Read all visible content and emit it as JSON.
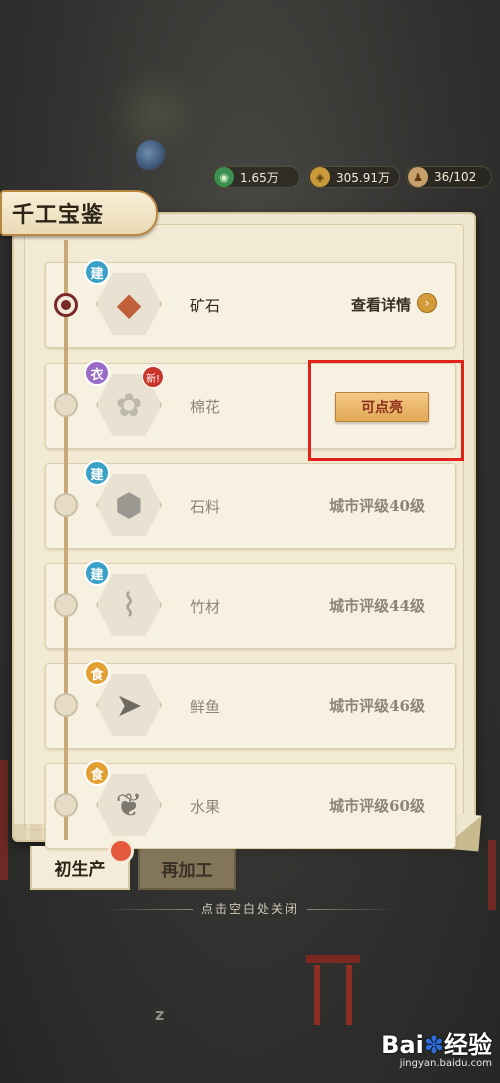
{
  "currency": [
    {
      "icon": "jade-coin-icon",
      "value": "1.65万"
    },
    {
      "icon": "copper-coin-icon",
      "value": "305.91万"
    },
    {
      "icon": "population-icon",
      "value": "36/102"
    }
  ],
  "panel": {
    "title": "千工宝鉴"
  },
  "items": [
    {
      "category": "建",
      "name": "矿石",
      "status": "查看详情",
      "icon": "ore-icon"
    },
    {
      "category": "衣",
      "name": "棉花",
      "status": "可点亮",
      "new_badge": "新!",
      "icon": "cotton-icon"
    },
    {
      "category": "建",
      "name": "石料",
      "status": "城市评级40级",
      "icon": "stone-icon"
    },
    {
      "category": "建",
      "name": "竹材",
      "status": "城市评级44级",
      "icon": "bamboo-icon"
    },
    {
      "category": "食",
      "name": "鲜鱼",
      "status": "城市评级46级",
      "icon": "fish-icon"
    },
    {
      "category": "食",
      "name": "水果",
      "status": "城市评级60级",
      "icon": "fruit-icon"
    }
  ],
  "tabs": {
    "primary": "初生产",
    "secondary": "再加工"
  },
  "close_hint": "点击空白处关闭",
  "watermark": {
    "logo_a": "Bai",
    "logo_b": "经验",
    "url": "jingyan.baidu.com"
  },
  "colors": {
    "highlight": "#e0221a",
    "accent": "#d49b3a",
    "parchment": "#f7f1e2"
  }
}
